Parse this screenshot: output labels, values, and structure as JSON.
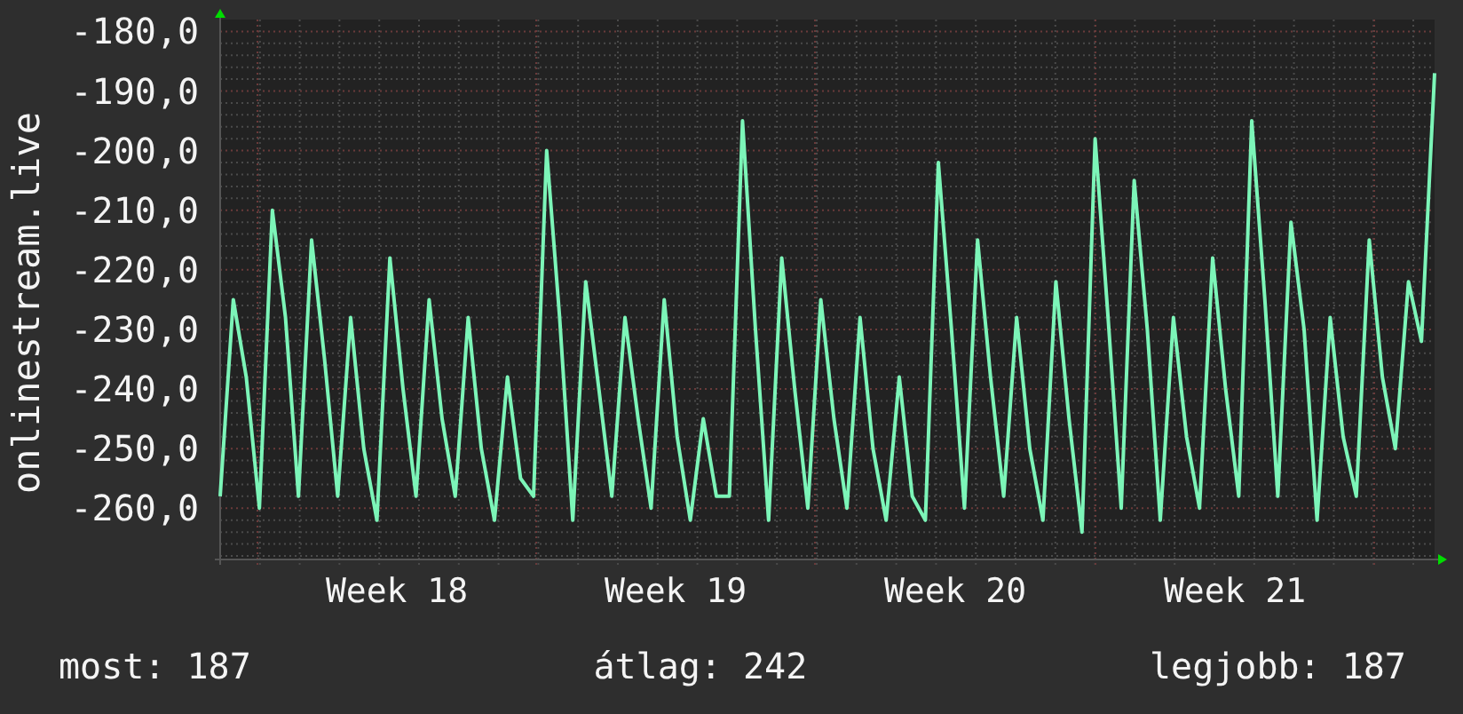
{
  "chart": {
    "chart_data": {
      "type": "line",
      "ylabel": "onlinestream.live",
      "ylim": [
        -268.6,
        -178.6
      ],
      "grid": true,
      "yticks": [
        {
          "value": -180,
          "label": "-180,0"
        },
        {
          "value": -190,
          "label": "-190,0"
        },
        {
          "value": -200,
          "label": "-200,0"
        },
        {
          "value": -210,
          "label": "-210,0"
        },
        {
          "value": -220,
          "label": "-220,0"
        },
        {
          "value": -230,
          "label": "-230,0"
        },
        {
          "value": -240,
          "label": "-240,0"
        },
        {
          "value": -250,
          "label": "-250,0"
        },
        {
          "value": -260,
          "label": "-260,0"
        }
      ],
      "series": [
        {
          "color": "#7cf5b8",
          "values": [
            -258,
            -225,
            -238,
            -260,
            -210,
            -228,
            -258,
            -215,
            -235,
            -258,
            -228,
            -250,
            -262,
            -218,
            -240,
            -258,
            -225,
            -245,
            -258,
            -228,
            -250,
            -262,
            -238,
            -255,
            -258,
            -200,
            -228,
            -262,
            -222,
            -240,
            -258,
            -228,
            -245,
            -260,
            -225,
            -248,
            -262,
            -245,
            -258,
            -258,
            -195,
            -230,
            -262,
            -218,
            -240,
            -260,
            -225,
            -245,
            -260,
            -228,
            -250,
            -262,
            -238,
            -258,
            -262,
            -202,
            -230,
            -260,
            -215,
            -238,
            -258,
            -228,
            -250,
            -262,
            -222,
            -245,
            -264,
            -198,
            -228,
            -260,
            -205,
            -230,
            -262,
            -228,
            -248,
            -260,
            -218,
            -240,
            -258,
            -195,
            -225,
            -258,
            -212,
            -230,
            -262,
            -228,
            -248,
            -258,
            -215,
            -238,
            -250,
            -222,
            -232,
            -187
          ]
        }
      ]
    },
    "week_labels": [
      {
        "label": "Week 18"
      },
      {
        "label": "Week 19"
      },
      {
        "label": "Week 20"
      },
      {
        "label": "Week 21"
      }
    ]
  },
  "footer": [
    {
      "label": "most: 187"
    },
    {
      "label": "átlag: 242"
    },
    {
      "label": "legjobb: 187"
    }
  ]
}
